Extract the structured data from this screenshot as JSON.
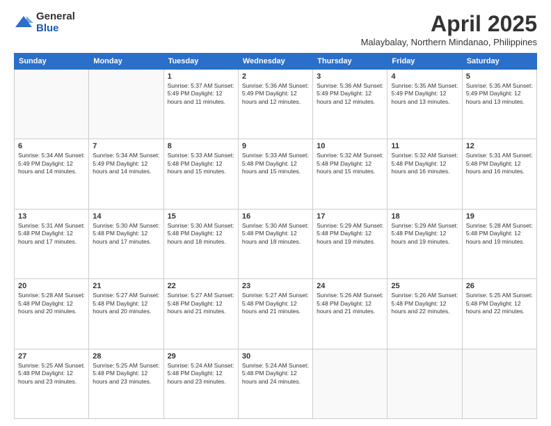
{
  "logo": {
    "general": "General",
    "blue": "Blue"
  },
  "title": {
    "month_year": "April 2025",
    "location": "Malaybalay, Northern Mindanao, Philippines"
  },
  "weekdays": [
    "Sunday",
    "Monday",
    "Tuesday",
    "Wednesday",
    "Thursday",
    "Friday",
    "Saturday"
  ],
  "weeks": [
    [
      {
        "day": "",
        "text": ""
      },
      {
        "day": "",
        "text": ""
      },
      {
        "day": "1",
        "text": "Sunrise: 5:37 AM\nSunset: 5:49 PM\nDaylight: 12 hours and 11 minutes."
      },
      {
        "day": "2",
        "text": "Sunrise: 5:36 AM\nSunset: 5:49 PM\nDaylight: 12 hours and 12 minutes."
      },
      {
        "day": "3",
        "text": "Sunrise: 5:36 AM\nSunset: 5:49 PM\nDaylight: 12 hours and 12 minutes."
      },
      {
        "day": "4",
        "text": "Sunrise: 5:35 AM\nSunset: 5:49 PM\nDaylight: 12 hours and 13 minutes."
      },
      {
        "day": "5",
        "text": "Sunrise: 5:35 AM\nSunset: 5:49 PM\nDaylight: 12 hours and 13 minutes."
      }
    ],
    [
      {
        "day": "6",
        "text": "Sunrise: 5:34 AM\nSunset: 5:49 PM\nDaylight: 12 hours and 14 minutes."
      },
      {
        "day": "7",
        "text": "Sunrise: 5:34 AM\nSunset: 5:49 PM\nDaylight: 12 hours and 14 minutes."
      },
      {
        "day": "8",
        "text": "Sunrise: 5:33 AM\nSunset: 5:48 PM\nDaylight: 12 hours and 15 minutes."
      },
      {
        "day": "9",
        "text": "Sunrise: 5:33 AM\nSunset: 5:48 PM\nDaylight: 12 hours and 15 minutes."
      },
      {
        "day": "10",
        "text": "Sunrise: 5:32 AM\nSunset: 5:48 PM\nDaylight: 12 hours and 15 minutes."
      },
      {
        "day": "11",
        "text": "Sunrise: 5:32 AM\nSunset: 5:48 PM\nDaylight: 12 hours and 16 minutes."
      },
      {
        "day": "12",
        "text": "Sunrise: 5:31 AM\nSunset: 5:48 PM\nDaylight: 12 hours and 16 minutes."
      }
    ],
    [
      {
        "day": "13",
        "text": "Sunrise: 5:31 AM\nSunset: 5:48 PM\nDaylight: 12 hours and 17 minutes."
      },
      {
        "day": "14",
        "text": "Sunrise: 5:30 AM\nSunset: 5:48 PM\nDaylight: 12 hours and 17 minutes."
      },
      {
        "day": "15",
        "text": "Sunrise: 5:30 AM\nSunset: 5:48 PM\nDaylight: 12 hours and 18 minutes."
      },
      {
        "day": "16",
        "text": "Sunrise: 5:30 AM\nSunset: 5:48 PM\nDaylight: 12 hours and 18 minutes."
      },
      {
        "day": "17",
        "text": "Sunrise: 5:29 AM\nSunset: 5:48 PM\nDaylight: 12 hours and 19 minutes."
      },
      {
        "day": "18",
        "text": "Sunrise: 5:29 AM\nSunset: 5:48 PM\nDaylight: 12 hours and 19 minutes."
      },
      {
        "day": "19",
        "text": "Sunrise: 5:28 AM\nSunset: 5:48 PM\nDaylight: 12 hours and 19 minutes."
      }
    ],
    [
      {
        "day": "20",
        "text": "Sunrise: 5:28 AM\nSunset: 5:48 PM\nDaylight: 12 hours and 20 minutes."
      },
      {
        "day": "21",
        "text": "Sunrise: 5:27 AM\nSunset: 5:48 PM\nDaylight: 12 hours and 20 minutes."
      },
      {
        "day": "22",
        "text": "Sunrise: 5:27 AM\nSunset: 5:48 PM\nDaylight: 12 hours and 21 minutes."
      },
      {
        "day": "23",
        "text": "Sunrise: 5:27 AM\nSunset: 5:48 PM\nDaylight: 12 hours and 21 minutes."
      },
      {
        "day": "24",
        "text": "Sunrise: 5:26 AM\nSunset: 5:48 PM\nDaylight: 12 hours and 21 minutes."
      },
      {
        "day": "25",
        "text": "Sunrise: 5:26 AM\nSunset: 5:48 PM\nDaylight: 12 hours and 22 minutes."
      },
      {
        "day": "26",
        "text": "Sunrise: 5:25 AM\nSunset: 5:48 PM\nDaylight: 12 hours and 22 minutes."
      }
    ],
    [
      {
        "day": "27",
        "text": "Sunrise: 5:25 AM\nSunset: 5:48 PM\nDaylight: 12 hours and 23 minutes."
      },
      {
        "day": "28",
        "text": "Sunrise: 5:25 AM\nSunset: 5:48 PM\nDaylight: 12 hours and 23 minutes."
      },
      {
        "day": "29",
        "text": "Sunrise: 5:24 AM\nSunset: 5:48 PM\nDaylight: 12 hours and 23 minutes."
      },
      {
        "day": "30",
        "text": "Sunrise: 5:24 AM\nSunset: 5:48 PM\nDaylight: 12 hours and 24 minutes."
      },
      {
        "day": "",
        "text": ""
      },
      {
        "day": "",
        "text": ""
      },
      {
        "day": "",
        "text": ""
      }
    ]
  ]
}
